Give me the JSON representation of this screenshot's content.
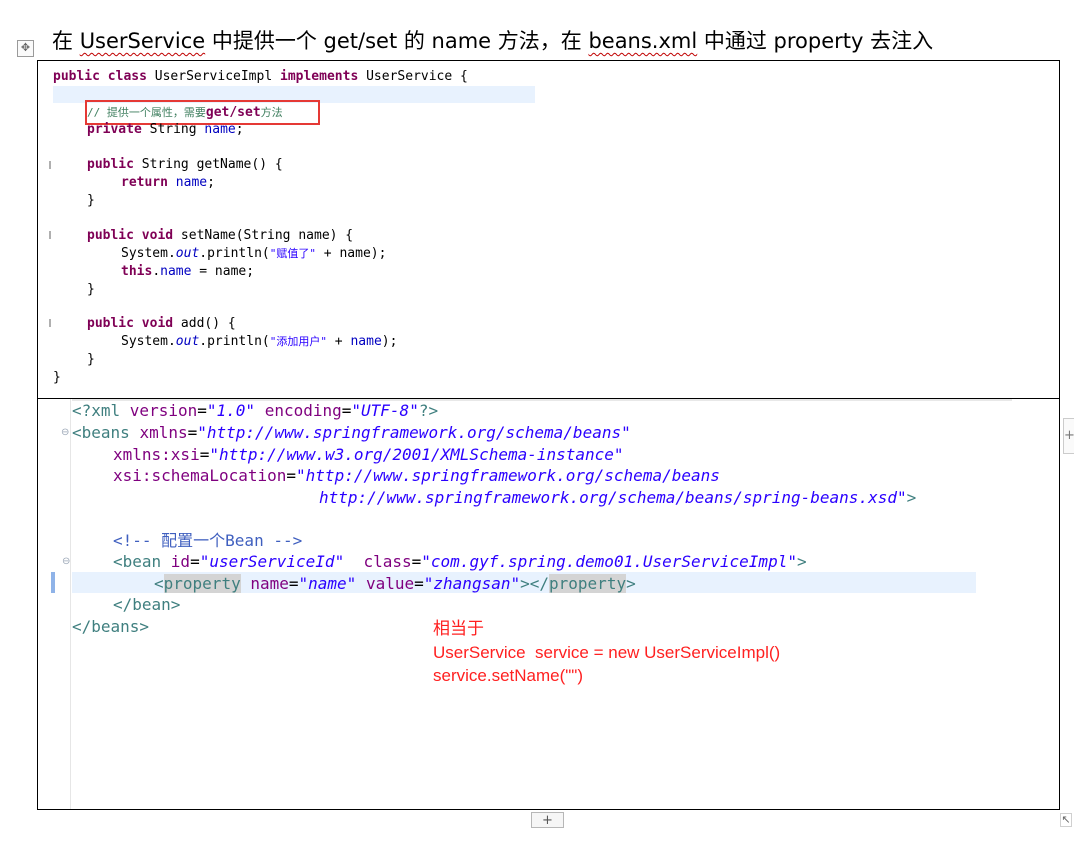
{
  "heading": {
    "prefix": "在 ",
    "class_name": "UserService",
    "middle": " 中提供一个 get/set 的 name 方法，在 ",
    "file_name": "beans.xml",
    "suffix": " 中通过 property 去注入"
  },
  "table": {
    "move_icon": "move-icon",
    "move_glyph": "✥",
    "add_row_glyph": "+",
    "side_glyph": "+",
    "resize_glyph": "↖"
  },
  "java": {
    "line1": {
      "k1": "public",
      "k2": "class",
      "name": " UserServiceImpl ",
      "k3": "implements",
      "rest": " UserService {"
    },
    "line2": {
      "comment": "// 提供一个属性，需要",
      "bold": "get/set",
      "tail": "方法"
    },
    "line3": {
      "k": "private",
      "type": " String ",
      "field": "name",
      "end": ";"
    },
    "line4": {
      "k": "public",
      "rest": " String getName() {"
    },
    "line5": {
      "k": "return",
      "sp": " ",
      "field": "name",
      "end": ";"
    },
    "line6": "}",
    "line7": {
      "k1": "public",
      "k2": "void",
      "rest": " setName(String name) {"
    },
    "line8": {
      "pre": "System.",
      "out": "out",
      "mid": ".println(",
      "str": "\"赋值了\"",
      "end": " + name);"
    },
    "line9": {
      "k": "this",
      "dot": ".",
      "field": "name",
      "end": " = name;"
    },
    "line10": "}",
    "line11": {
      "k1": "public",
      "k2": "void",
      "rest": " add() {"
    },
    "line12": {
      "pre": "System.",
      "out": "out",
      "mid": ".println(",
      "str": "\"添加用户\"",
      "plus": " + ",
      "field": "name",
      "end": ");"
    },
    "line13": "}",
    "line14": "}"
  },
  "xml": {
    "decl": {
      "open": "<?xml ",
      "a1": "version",
      "eq": "=",
      "v1": "\"1.0\"",
      "sp": " ",
      "a2": "encoding",
      "v2": "\"UTF-8\"",
      "close": "?>"
    },
    "beans_open": {
      "tag": "<beans ",
      "attr": "xmlns",
      "eq": "=",
      "val": "\"http://www.springframework.org/schema/beans\""
    },
    "xsi": {
      "attr": "xmlns:xsi",
      "eq": "=",
      "val": "\"http://www.w3.org/2001/XMLSchema-instance\""
    },
    "schema": {
      "attr": "xsi:schemaLocation",
      "eq": "=",
      "val": "\"http://www.springframework.org/schema/beans"
    },
    "schema2": {
      "val": "http://www.springframework.org/schema/beans/spring-beans.xsd\"",
      "close": ">"
    },
    "comment": "<!-- 配置一个Bean -->",
    "bean": {
      "tag": "<bean ",
      "a1": "id",
      "eq": "=",
      "v1": "\"userServiceId\"",
      "sp": "  ",
      "a2": "class",
      "v2": "\"com.gyf.spring.demo01.UserServiceImpl\"",
      "close": ">"
    },
    "property": {
      "lt": "<",
      "tag": "property",
      "sp": " ",
      "a1": "name",
      "eq": "=",
      "v1": "\"name\"",
      "a2": "value",
      "q": "\"",
      "v2": "zhangsan\"",
      "mid": "></",
      "tag2": "property",
      "gt": ">"
    },
    "bean_close": "</bean>",
    "beans_close": "</beans>"
  },
  "explanation": {
    "line1": "相当于",
    "line2": "UserService  service = new UserServiceImpl()",
    "line3": "service.setName(\"\")"
  },
  "colors": {
    "keyword": "#7f0055",
    "field": "#0000c0",
    "string": "#2a00ff",
    "comment": "#3f7f5f",
    "annotation": "#ff2020",
    "highlight_box": "#e53935"
  }
}
